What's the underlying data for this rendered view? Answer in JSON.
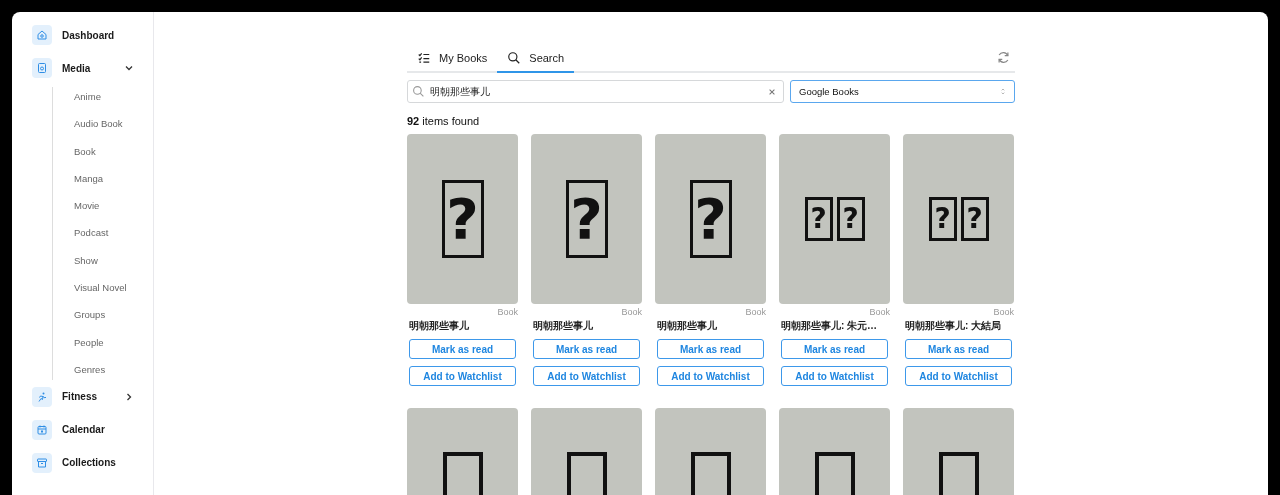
{
  "sidebar": {
    "items": [
      {
        "label": "Dashboard",
        "selected": false
      },
      {
        "label": "Media",
        "expanded": true,
        "children": [
          {
            "label": "Anime"
          },
          {
            "label": "Audio Book"
          },
          {
            "label": "Book"
          },
          {
            "label": "Manga"
          },
          {
            "label": "Movie"
          },
          {
            "label": "Podcast"
          },
          {
            "label": "Show"
          },
          {
            "label": "Visual Novel"
          },
          {
            "label": "Groups"
          },
          {
            "label": "People"
          },
          {
            "label": "Genres"
          }
        ]
      },
      {
        "label": "Fitness",
        "expanded": false
      },
      {
        "label": "Calendar"
      },
      {
        "label": "Collections"
      }
    ]
  },
  "tabs": [
    {
      "label": "My Books",
      "selected": false
    },
    {
      "label": "Search",
      "selected": true
    }
  ],
  "search": {
    "value": "明朝那些事儿"
  },
  "source_select": {
    "value": "Google Books"
  },
  "result_count": {
    "number": "92",
    "label": "items found"
  },
  "cards": [
    {
      "kind": "result",
      "cover_glyphs": [
        "?"
      ],
      "type": "Book",
      "title": "明朝那些事儿",
      "buttons": [
        "Mark as read",
        "Add to Watchlist"
      ]
    },
    {
      "kind": "result",
      "cover_glyphs": [
        "?"
      ],
      "type": "Book",
      "title": "明朝那些事儿",
      "buttons": [
        "Mark as read",
        "Add to Watchlist"
      ]
    },
    {
      "kind": "result",
      "cover_glyphs": [
        "?"
      ],
      "type": "Book",
      "title": "明朝那些事儿",
      "buttons": [
        "Mark as read",
        "Add to Watchlist"
      ]
    },
    {
      "kind": "result",
      "cover_glyphs": [
        "?",
        "?"
      ],
      "type": "Book",
      "title": "明朝那些事儿: 朱元…",
      "buttons": [
        "Mark as read",
        "Add to Watchlist"
      ]
    },
    {
      "kind": "result",
      "cover_glyphs": [
        "?",
        "?"
      ],
      "type": "Book",
      "title": "明朝那些事儿: 大結局",
      "buttons": [
        "Mark as read",
        "Add to Watchlist"
      ]
    },
    {
      "kind": "cover"
    },
    {
      "kind": "cover"
    },
    {
      "kind": "cover"
    },
    {
      "kind": "cover"
    },
    {
      "kind": "cover"
    }
  ]
}
